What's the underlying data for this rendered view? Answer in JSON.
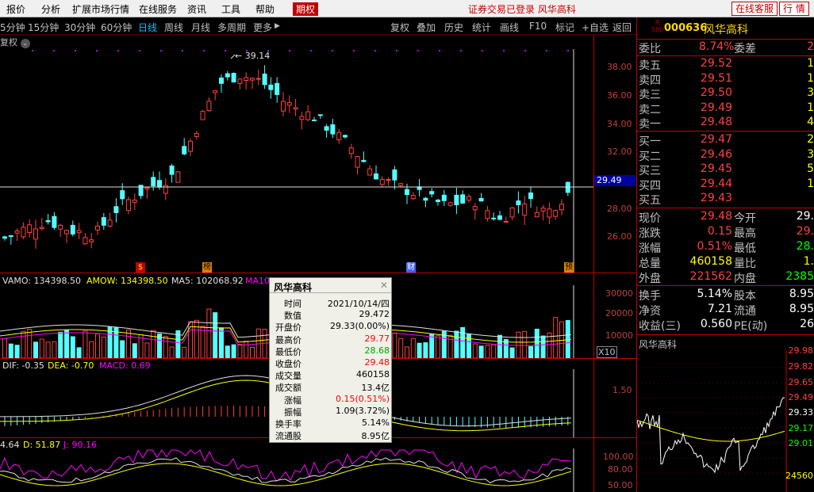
{
  "menu": {
    "items": [
      "报价",
      "分析",
      "扩展市场行情",
      "在线服务",
      "资讯",
      "工具",
      "帮助"
    ],
    "active": "期权",
    "status": "证券交易已登录  风华高科",
    "online_service": "在线客服",
    "quote_btn": "行 情"
  },
  "toolbar": {
    "periods": [
      "5分钟",
      "15分钟",
      "30分钟",
      "60分钟",
      "日线",
      "周线",
      "月线",
      "多周期",
      "更多"
    ],
    "active_period": "日线",
    "right_items": [
      "复权",
      "叠加",
      "历史",
      "统计",
      "画线",
      "F10",
      "标记",
      "+自选",
      "返回"
    ],
    "adjust_label": "复权"
  },
  "price_pane": {
    "peak_label": "39.14",
    "current_price_tag": "29.49",
    "y_ticks": [
      "38.00",
      "36.00",
      "34.00",
      "32.00",
      "30.00",
      "28.00",
      "26.00"
    ],
    "markers": [
      "$",
      "榜",
      "财",
      "预"
    ]
  },
  "volume_pane": {
    "indicators": [
      {
        "text": "VAMO: 134398.50",
        "color": "#e0e0e0"
      },
      {
        "text": "AMOW: 134398.50",
        "color": "#ffff00"
      },
      {
        "text": "MA5: 102068.92",
        "color": "#e0e0e0"
      },
      {
        "text": "MA10: 1...",
        "color": "#ff00ff"
      }
    ],
    "y_ticks": [
      "30000",
      "20000",
      "10000"
    ],
    "unit": "X10"
  },
  "macd_pane": {
    "indicators": [
      {
        "text": "DIF: -0.35",
        "color": "#e0e0e0"
      },
      {
        "text": "DEA: -0.70",
        "color": "#ffff00"
      },
      {
        "text": "MACD: 0.69",
        "color": "#ff00ff"
      }
    ],
    "y_ticks": [
      "1.50"
    ]
  },
  "kdj_pane": {
    "indicators": [
      {
        "text": "4.64",
        "color": "#e0e0e0"
      },
      {
        "text": "D: 51.87",
        "color": "#ffff00"
      },
      {
        "text": "J: 90.16",
        "color": "#ff00ff"
      }
    ],
    "y_ticks": [
      "100.00",
      "80.00",
      "50.00"
    ]
  },
  "tooltip": {
    "title": "风华高科",
    "rows": [
      {
        "k": "时间",
        "v": "2021/10/14/四",
        "c": "#000000"
      },
      {
        "k": "数值",
        "v": "29.472",
        "c": "#000000"
      },
      {
        "k": "开盘价",
        "v": "29.33(0.00%)",
        "c": "#000000"
      },
      {
        "k": "最高价",
        "v": "29.77",
        "c": "#ff0000"
      },
      {
        "k": "最低价",
        "v": "28.68",
        "c": "#00a000"
      },
      {
        "k": "收盘价",
        "v": "29.48",
        "c": "#ff0000"
      },
      {
        "k": "成交量",
        "v": "460158",
        "c": "#000000"
      },
      {
        "k": "成交额",
        "v": "13.4亿",
        "c": "#000000"
      },
      {
        "k": "涨幅",
        "v": "0.15(0.51%)",
        "c": "#ff0000"
      },
      {
        "k": "振幅",
        "v": "1.09(3.72%)",
        "c": "#000000"
      },
      {
        "k": "换手率",
        "v": "5.14%",
        "c": "#000000"
      },
      {
        "k": "流通股",
        "v": "8.95亿",
        "c": "#000000"
      }
    ]
  },
  "quote": {
    "code": "000636",
    "name": "风华高科",
    "r_icon": [
      "R",
      "500"
    ],
    "wei_bi": {
      "label": "委比",
      "value": "8.74%",
      "label2": "委差",
      "value2": "2"
    },
    "sells": [
      {
        "label": "卖五",
        "price": "29.52",
        "vol": "1"
      },
      {
        "label": "卖四",
        "price": "29.51",
        "vol": "1"
      },
      {
        "label": "卖三",
        "price": "29.50",
        "vol": "3"
      },
      {
        "label": "卖二",
        "price": "29.49",
        "vol": "1"
      },
      {
        "label": "卖一",
        "price": "29.48",
        "vol": "4"
      }
    ],
    "buys": [
      {
        "label": "买一",
        "price": "29.47",
        "vol": "2"
      },
      {
        "label": "买二",
        "price": "29.46",
        "vol": "3"
      },
      {
        "label": "买三",
        "price": "29.45",
        "vol": "5"
      },
      {
        "label": "买四",
        "price": "29.44",
        "vol": "1"
      },
      {
        "label": "买五",
        "price": "29.43",
        "vol": ""
      }
    ],
    "stats": [
      {
        "l1": "现价",
        "v1": "29.48",
        "c1": "#ff4040",
        "l2": "今开",
        "v2": "29.",
        "c2": "#ffffff"
      },
      {
        "l1": "涨跌",
        "v1": "0.15",
        "c1": "#ff4040",
        "l2": "最高",
        "v2": "29.",
        "c2": "#ff4040"
      },
      {
        "l1": "涨幅",
        "v1": "0.51%",
        "c1": "#ff4040",
        "l2": "最低",
        "v2": "28.",
        "c2": "#00ff00"
      },
      {
        "l1": "总量",
        "v1": "460158",
        "c1": "#ffff00",
        "l2": "量比",
        "v2": "1.",
        "c2": "#ffff00"
      },
      {
        "l1": "外盘",
        "v1": "221562",
        "c1": "#ff4040",
        "l2": "内盘",
        "v2": "2385",
        "c2": "#00ff00"
      }
    ],
    "stats2": [
      {
        "l1": "换手",
        "v1": "5.14%",
        "c1": "#ffffff",
        "l2": "股本",
        "v2": "8.95",
        "c2": "#ffffff"
      },
      {
        "l1": "净资",
        "v1": "7.21",
        "c1": "#ffffff",
        "l2": "流通",
        "v2": "8.95",
        "c2": "#ffffff"
      },
      {
        "l1": "收益(三)",
        "v1": "0.560",
        "c1": "#ffffff",
        "l2": "PE(动)",
        "v2": "26",
        "c2": "#ffffff"
      }
    ]
  },
  "mini_chart": {
    "title": "风华高科",
    "y_ticks": [
      {
        "v": "29.98",
        "c": "#ff4040"
      },
      {
        "v": "29.82",
        "c": "#ff4040"
      },
      {
        "v": "29.65",
        "c": "#ff4040"
      },
      {
        "v": "29.49",
        "c": "#ff4040"
      },
      {
        "v": "29.33",
        "c": "#ffffff"
      },
      {
        "v": "29.17",
        "c": "#00ff00"
      },
      {
        "v": "29.01",
        "c": "#00ff00"
      },
      {
        "v": "24560",
        "c": "#ffff00"
      }
    ]
  },
  "colors": {
    "up": "#ff4040",
    "down": "#54ffff",
    "grid": "#c00000",
    "ma_yellow": "#ffff00",
    "ma_white": "#e0e0e0",
    "ma_magenta": "#ff00ff"
  }
}
